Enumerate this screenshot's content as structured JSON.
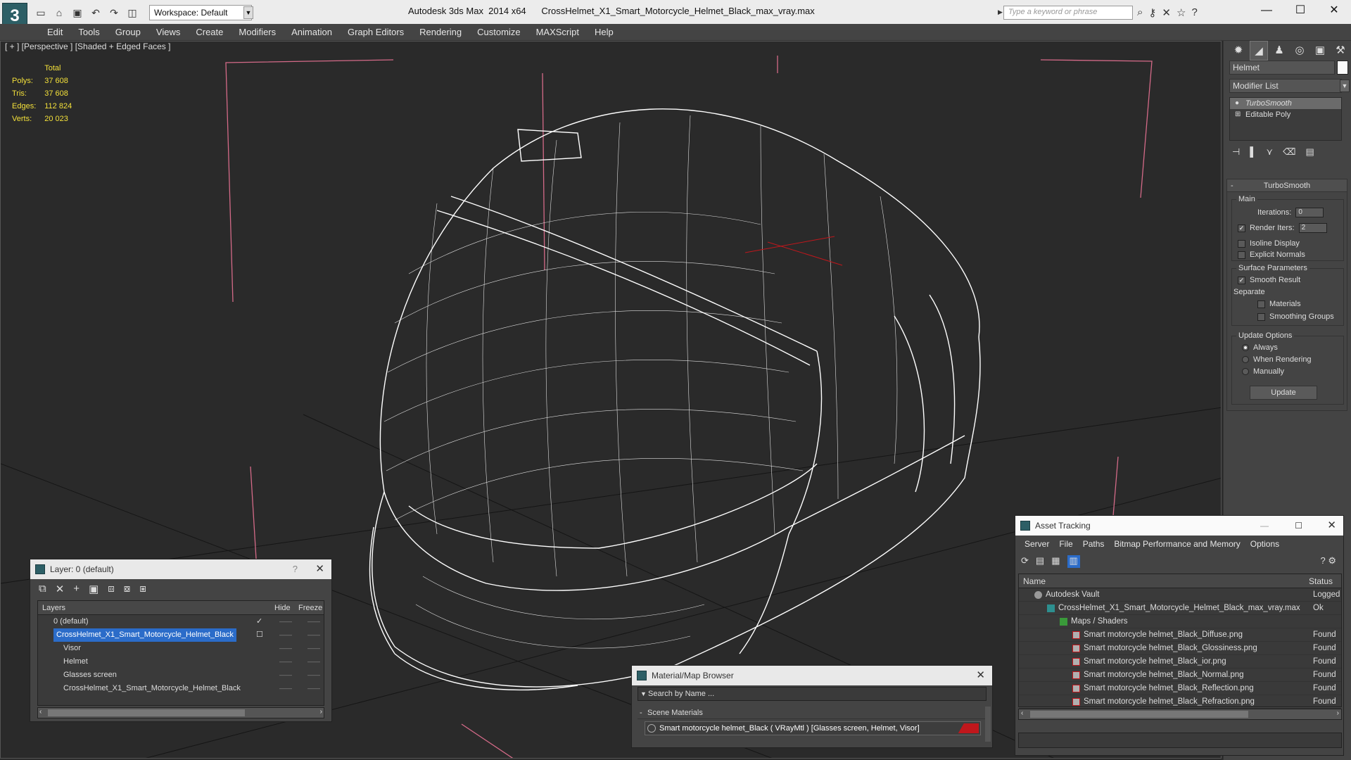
{
  "titlebar": {
    "workspace": "Workspace: Default",
    "title": "Autodesk 3ds Max  2014 x64      CrossHelmet_X1_Smart_Motorcycle_Helmet_Black_max_vray.max",
    "search_placeholder": "Type a keyword or phrase",
    "qat_icons": [
      "new-file-icon",
      "open-file-icon",
      "save-icon",
      "undo-icon",
      "redo-icon",
      "project-folder-icon"
    ],
    "help_icons": [
      "binoculars-icon",
      "key-icon",
      "exchange-icon",
      "star-icon",
      "help-icon"
    ]
  },
  "menu": [
    "Edit",
    "Tools",
    "Group",
    "Views",
    "Create",
    "Modifiers",
    "Animation",
    "Graph Editors",
    "Rendering",
    "Customize",
    "MAXScript",
    "Help"
  ],
  "viewport": {
    "label": "[ + ] [Perspective ] [Shaded + Edged Faces ]",
    "stats": {
      "total_label": "Total",
      "rows": [
        {
          "label": "Polys:",
          "value": "37 608"
        },
        {
          "label": "Tris:",
          "value": "37 608"
        },
        {
          "label": "Edges:",
          "value": "112 824"
        },
        {
          "label": "Verts:",
          "value": "20 023"
        }
      ]
    },
    "colors": {
      "stats": "#f3e03a",
      "bbox": "#d46a88",
      "wire": "#ffffff",
      "grid": "#151515"
    }
  },
  "command_panel": {
    "object_name": "Helmet",
    "modifier_list": "Modifier List",
    "stack": [
      {
        "label": "TurboSmooth",
        "active": true
      },
      {
        "label": "Editable Poly",
        "active": false
      }
    ],
    "rollout_title": "TurboSmooth",
    "main_label": "Main",
    "iterations_label": "Iterations:",
    "iterations_value": "0",
    "render_iters_label": "Render Iters:",
    "render_iters_value": "2",
    "isoline_label": "Isoline Display",
    "explicit_normals_label": "Explicit Normals",
    "surface_params_label": "Surface Parameters",
    "smooth_result_label": "Smooth Result",
    "separate_label": "Separate",
    "materials_label": "Materials",
    "smoothing_groups_label": "Smoothing Groups",
    "update_options_label": "Update Options",
    "always_label": "Always",
    "when_rendering_label": "When Rendering",
    "manually_label": "Manually",
    "update_button": "Update"
  },
  "layer_dialog": {
    "title": "Layer: 0 (default)",
    "help": "?",
    "col_layers": "Layers",
    "col_hide": "Hide",
    "col_freeze": "Freeze",
    "rows": [
      {
        "name": "0 (default)",
        "indent": 1
      },
      {
        "name": "CrossHelmet_X1_Smart_Motorcycle_Helmet_Black",
        "indent": 1
      },
      {
        "name": "Visor",
        "indent": 2
      },
      {
        "name": "Helmet",
        "indent": 2
      },
      {
        "name": "Glasses screen",
        "indent": 2
      },
      {
        "name": "CrossHelmet_X1_Smart_Motorcycle_Helmet_Black",
        "indent": 2
      }
    ]
  },
  "material_browser": {
    "title": "Material/Map Browser",
    "search": "Search by Name ...",
    "section": "Scene Materials",
    "item": "Smart motorcycle helmet_Black  ( VRayMtl )  [Glasses screen, Helmet, Visor]"
  },
  "asset_tracking": {
    "title": "Asset Tracking",
    "menu": [
      "Server",
      "File",
      "Paths",
      "Bitmap Performance and Memory",
      "Options"
    ],
    "col_name": "Name",
    "col_status": "Status",
    "rows": [
      {
        "name": "Autodesk Vault",
        "status": "Logged",
        "indent": 1,
        "icon": "vault-icon"
      },
      {
        "name": "CrossHelmet_X1_Smart_Motorcycle_Helmet_Black_max_vray.max",
        "status": "Ok",
        "indent": 2,
        "icon": "max-file-icon"
      },
      {
        "name": "Maps / Shaders",
        "status": "",
        "indent": 3,
        "icon": "maps-icon"
      },
      {
        "name": "Smart motorcycle helmet_Black_Diffuse.png",
        "status": "Found",
        "indent": 4,
        "icon": "png-icon"
      },
      {
        "name": "Smart motorcycle helmet_Black_Glossiness.png",
        "status": "Found",
        "indent": 4,
        "icon": "png-icon"
      },
      {
        "name": "Smart motorcycle helmet_Black_ior.png",
        "status": "Found",
        "indent": 4,
        "icon": "png-icon"
      },
      {
        "name": "Smart motorcycle helmet_Black_Normal.png",
        "status": "Found",
        "indent": 4,
        "icon": "png-icon"
      },
      {
        "name": "Smart motorcycle helmet_Black_Reflection.png",
        "status": "Found",
        "indent": 4,
        "icon": "png-icon"
      },
      {
        "name": "Smart motorcycle helmet_Black_Refraction.png",
        "status": "Found",
        "indent": 4,
        "icon": "png-icon"
      }
    ]
  }
}
